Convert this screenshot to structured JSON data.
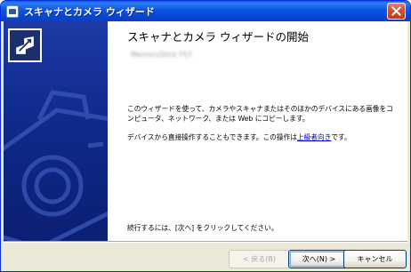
{
  "window": {
    "title": "スキャナとカメラ ウィザード"
  },
  "main": {
    "heading": "スキャナとカメラ ウィザードの開始",
    "device_name": "MemoryStick FS7",
    "paragraph1": "このウィザードを使って、カメラやスキャナまたはそのほかのデバイスにある画像をコンピュータ、ネットワーク、または Web にコピーします。",
    "paragraph2_prefix": "デバイスから直接操作することもできます。この操作は",
    "paragraph2_link": "上級者向き",
    "paragraph2_suffix": "です。",
    "paragraph3": "続行するには、[次へ] をクリックしてください。"
  },
  "buttons": {
    "back": "< 戻る(B)",
    "next": "次へ(N) >",
    "cancel": "キャンセル"
  },
  "colors": {
    "titlebar": "#0a5fe8",
    "sidebar": "#0f2a8c",
    "link": "#0000ee"
  }
}
